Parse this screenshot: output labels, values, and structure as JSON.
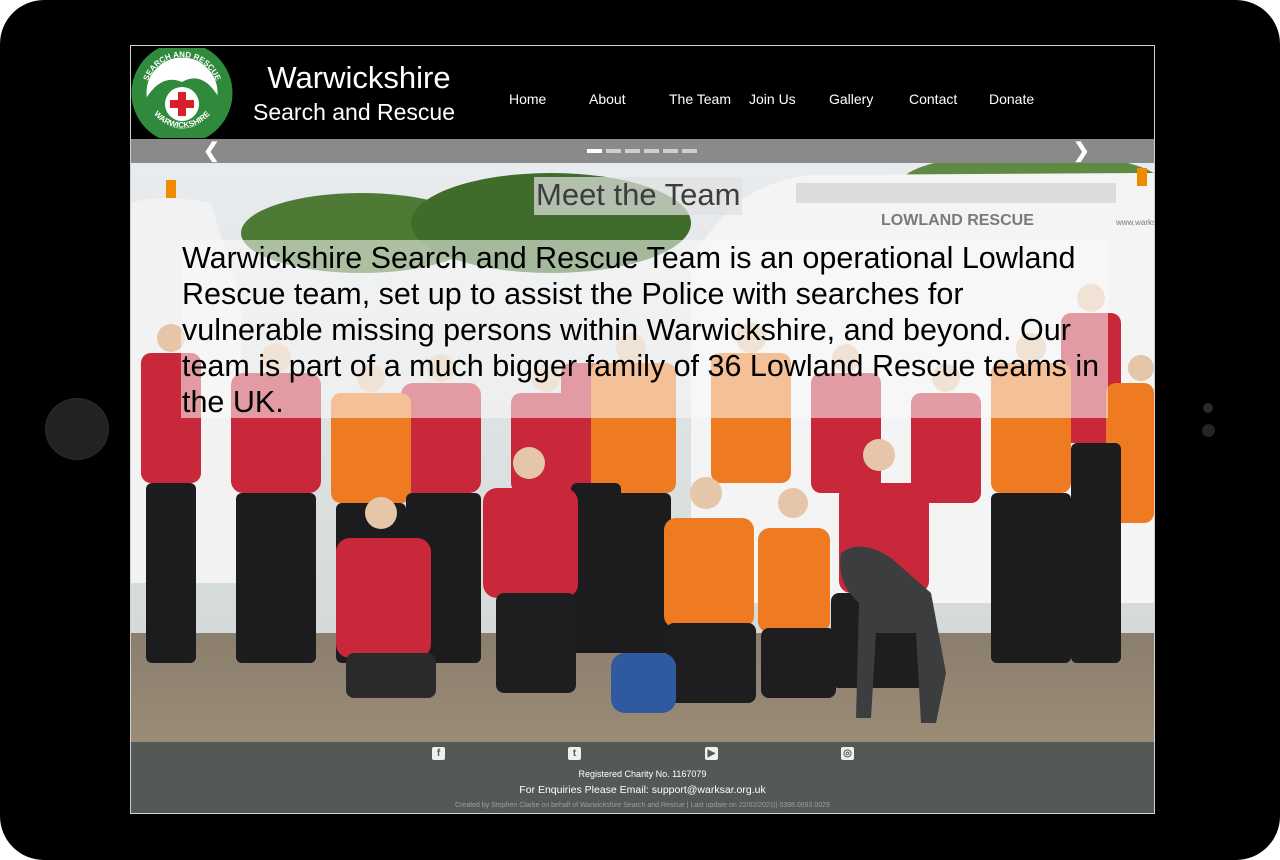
{
  "header": {
    "title": "Warwickshire",
    "subtitle": "Search and Rescue",
    "logo": {
      "ring_top_text": "SEARCH AND RESCUE",
      "ring_bottom_text": "WARWICKSHIRE"
    }
  },
  "nav": {
    "items": [
      {
        "label": "Home"
      },
      {
        "label": "About"
      },
      {
        "label": "The Team"
      },
      {
        "label": "Join Us"
      },
      {
        "label": "Gallery"
      },
      {
        "label": "Contact"
      },
      {
        "label": "Donate"
      }
    ]
  },
  "slider": {
    "prev": "❮",
    "next": "❯",
    "slide_count": 6,
    "active_slide": 1
  },
  "hero": {
    "heading": "Meet the Team",
    "intro": "Warwickshire Search and Rescue Team is an operational Lowland Rescue team, set up to assist the Police with searches for vulnerable missing persons within Warwickshire, and beyond. Our team is part of a much bigger family of 36 Lowland Rescue teams in the UK.",
    "van_text": "LOWLAND RESCUE",
    "van_url_fragment": "www.warks"
  },
  "footer": {
    "social": {
      "facebook": "f",
      "twitter": "t",
      "youtube": "▶",
      "instagram": "◎"
    },
    "charity": "Registered Charity No. 1167079",
    "enquiry": "For Enquiries Please Email: support@warksar.org.uk",
    "credit": "Created by Stephen Clarke on behalf of Warwickshire Search and Rescue | Last update on 22/02/2021|| 0398.0693.0029"
  },
  "colors": {
    "background": "#000000",
    "slider_bar": "#8a8a8a",
    "footer": "#535a55",
    "logo_green": "#2f8a3c",
    "logo_red": "#d9202a",
    "jacket_red": "#c8283a",
    "jacket_orange": "#ee7a22"
  }
}
